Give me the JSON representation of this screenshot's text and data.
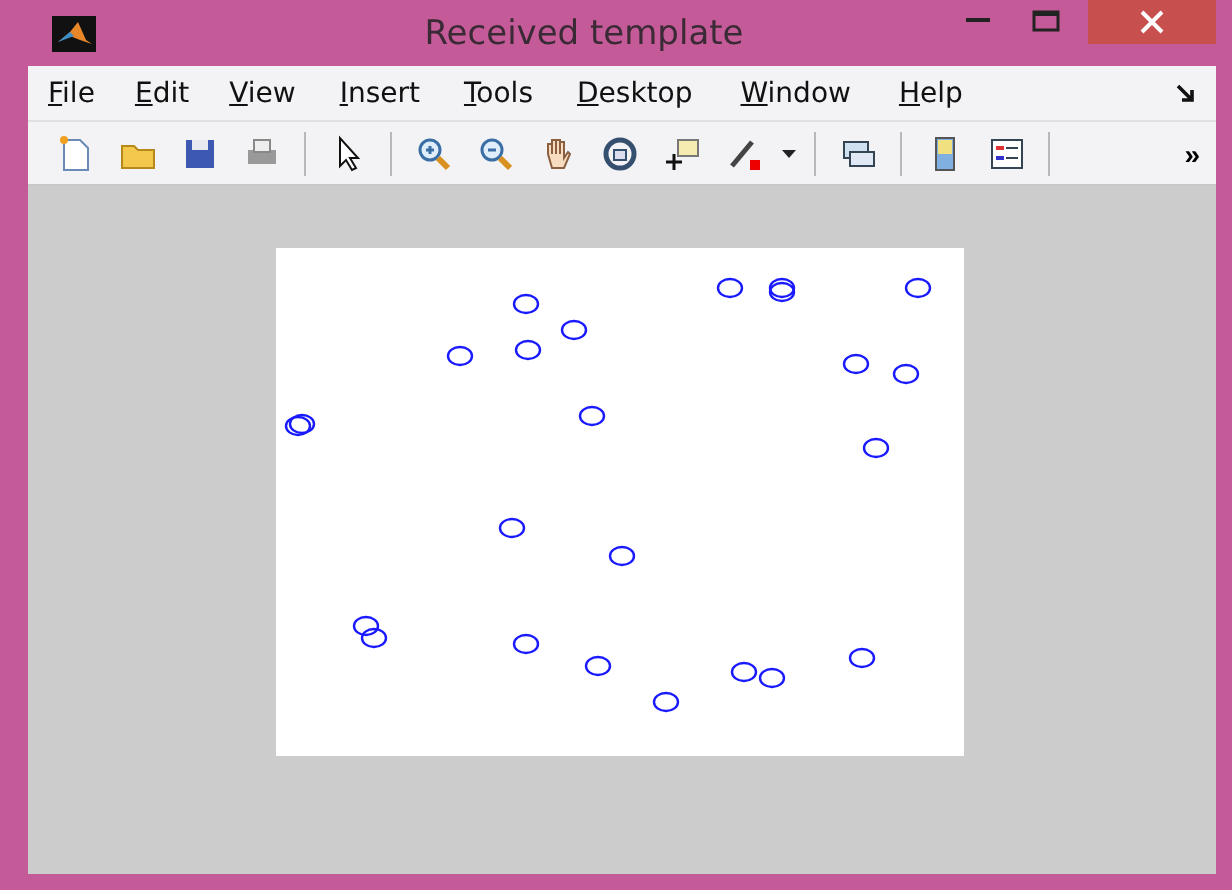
{
  "window": {
    "title": "Received template"
  },
  "menu": [
    {
      "label": "File"
    },
    {
      "label": "Edit"
    },
    {
      "label": "View"
    },
    {
      "label": "Insert"
    },
    {
      "label": "Tools"
    },
    {
      "label": "Desktop"
    },
    {
      "label": "Window"
    },
    {
      "label": "Help"
    }
  ],
  "toolbar": {
    "overflow": "»"
  }
}
